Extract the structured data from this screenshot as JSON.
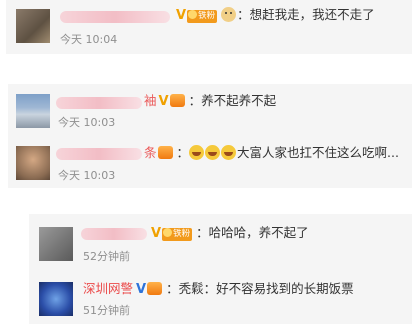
{
  "colors": {
    "card_bg": "#f5f5f5",
    "verified_gold": "#f0a100",
    "fan_badge": "#f29a1c",
    "name_red": "#eb5a5a",
    "name_blue_v": "#2e73d9"
  },
  "comments": [
    {
      "badge_text": "铁粉",
      "text": "：想赶我走，我还不走了",
      "emoji_icons": [
        "dog-face-emoji"
      ],
      "time": "今天 10:04"
    },
    {
      "name_fragment": "袖",
      "text": "：养不起养不起",
      "time": "今天 10:03"
    },
    {
      "name_fragment": "条",
      "text": "大富人家也扛不住这么吃啊...",
      "emoji_icons": [
        "laugh-cry-emoji",
        "laugh-cry-emoji",
        "laugh-cry-emoji"
      ],
      "time": "今天 10:03"
    }
  ],
  "replies": [
    {
      "badge_text": "铁粉",
      "text": "：哈哈哈，养不起了",
      "time": "52分钟前"
    },
    {
      "name": "深圳网警",
      "text": "：秃鬏：好不容易找到的长期饭票",
      "time": "51分钟前"
    }
  ]
}
